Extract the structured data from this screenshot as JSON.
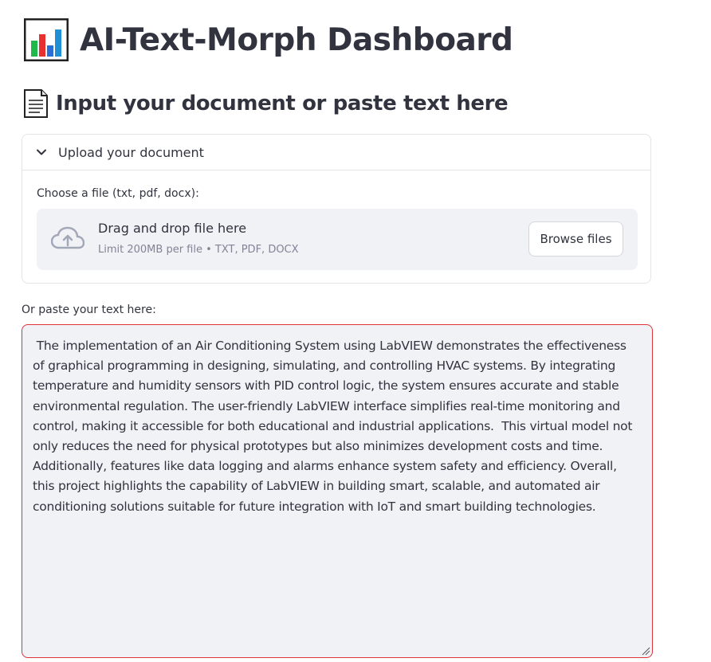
{
  "header": {
    "title": "AI-Text-Morph Dashboard",
    "title_icon": "bar-chart-icon"
  },
  "input_section": {
    "heading": "Input your document or paste text here",
    "heading_icon": "document-icon"
  },
  "uploader": {
    "expander_label": "Upload your document",
    "expander_icon": "chevron-down-icon",
    "file_label": "Choose a file (txt, pdf, docx):",
    "drop_text": "Drag and drop file here",
    "limit_text": "Limit 200MB per file • TXT, PDF, DOCX",
    "browse_label": "Browse files",
    "upload_icon": "cloud-upload-icon"
  },
  "paste": {
    "label": "Or paste your text here:",
    "value": " The implementation of an Air Conditioning System using LabVIEW demonstrates the effectiveness of graphical programming in designing, simulating, and controlling HVAC systems. By integrating temperature and humidity sensors with PID control logic, the system ensures accurate and stable environmental regulation. The user-friendly LabVIEW interface simplifies real-time monitoring and control, making it accessible for both educational and industrial applications.  This virtual model not only reduces the need for physical prototypes but also minimizes development costs and time. Additionally, features like data logging and alarms enhance system safety and efficiency. Overall, this project highlights the capability of LabVIEW in building smart, scalable, and automated air conditioning solutions suitable for future integration with IoT and smart building technologies."
  },
  "colors": {
    "text": "#31333f",
    "muted": "#808495",
    "panel_bg": "#f0f2f6",
    "error_border": "#e0323a",
    "border": "#e3e4e8"
  }
}
